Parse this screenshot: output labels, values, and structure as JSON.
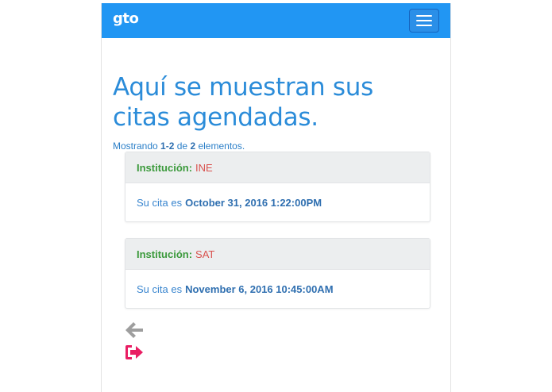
{
  "navbar": {
    "brand": "gto"
  },
  "main": {
    "title": "Aquí se muestran sus citas agendadas.",
    "summary": {
      "prefix": "Mostrando",
      "range": "1-2",
      "of": "de",
      "total": "2",
      "suffix": "elementos."
    },
    "appointments": [
      {
        "institution_label": "Institución:",
        "institution": "INE",
        "date_prefix": "Su cita es",
        "date": "October 31, 2016 1:22:00PM"
      },
      {
        "institution_label": "Institución:",
        "institution": "SAT",
        "date_prefix": "Su cita es",
        "date": "November 6, 2016 10:45:00AM"
      }
    ]
  },
  "icons": {
    "back": "arrow-left-icon",
    "logout": "sign-out-icon"
  },
  "colors": {
    "navbar": "#2196f3",
    "title": "#2b8cd9",
    "institution_label": "#3c9a3c",
    "institution_value": "#d9534f",
    "back_icon": "#9e9e9e",
    "logout_icon": "#e91e63"
  }
}
